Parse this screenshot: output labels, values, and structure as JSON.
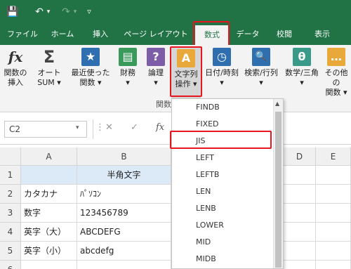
{
  "quick_access": {
    "save": "💾",
    "undo": "↶",
    "undo_arrow": "▾",
    "redo": "↷",
    "redo_arrow": "▾",
    "customize": "▿"
  },
  "tabs": [
    {
      "label": "ファイル"
    },
    {
      "label": "ホーム"
    },
    {
      "label": "挿入"
    },
    {
      "label": "ページ レイアウト"
    },
    {
      "label": "数式"
    },
    {
      "label": "データ"
    },
    {
      "label": "校閲"
    },
    {
      "label": "表示"
    }
  ],
  "ribbon": {
    "buttons": [
      {
        "icon": "fx",
        "line1": "関数の",
        "line2": "挿入"
      },
      {
        "icon": "Σ",
        "line1": "オート",
        "line2": "SUM ▾"
      },
      {
        "icon": "★",
        "line1": "最近使った",
        "line2": "関数 ▾"
      },
      {
        "icon": "▤",
        "line1": "財務",
        "line2": "▾"
      },
      {
        "icon": "?",
        "line1": "論理",
        "line2": "▾"
      },
      {
        "icon": "A",
        "line1": "文字列",
        "line2": "操作 ▾"
      },
      {
        "icon": "◷",
        "line1": "日付/時刻",
        "line2": "▾"
      },
      {
        "icon": "🔍",
        "line1": "検索/行列",
        "line2": "▾"
      },
      {
        "icon": "θ",
        "line1": "数学/三角",
        "line2": "▾"
      },
      {
        "icon": "…",
        "line1": "その他の",
        "line2": "関数 ▾"
      }
    ],
    "group_label": "関数"
  },
  "formula_bar": {
    "name_box": "C2",
    "name_arrow": "▾",
    "more": "⋮",
    "cancel": "✕",
    "enter": "✓",
    "fx": "fx"
  },
  "columns": [
    "A",
    "B",
    "D",
    "E"
  ],
  "rows": [
    {
      "num": "1",
      "a": "",
      "b": "半角文字"
    },
    {
      "num": "2",
      "a": "カタカナ",
      "b": "ﾊﾟｿｺﾝ"
    },
    {
      "num": "3",
      "a": "数字",
      "b": "123456789"
    },
    {
      "num": "4",
      "a": "英字（大）",
      "b": "ABCDEFG"
    },
    {
      "num": "5",
      "a": "英字（小）",
      "b": "abcdefg"
    },
    {
      "num": "6",
      "a": "",
      "b": ""
    }
  ],
  "dropdown": {
    "items": [
      "FINDB",
      "FIXED",
      "JIS",
      "LEFT",
      "LEFTB",
      "LEN",
      "LENB",
      "LOWER",
      "MID",
      "MIDB"
    ],
    "scroll_up": "▲"
  },
  "colors": {
    "accent": "#217346",
    "highlight": "#e8141e",
    "header_fill": "#dce9f6"
  }
}
